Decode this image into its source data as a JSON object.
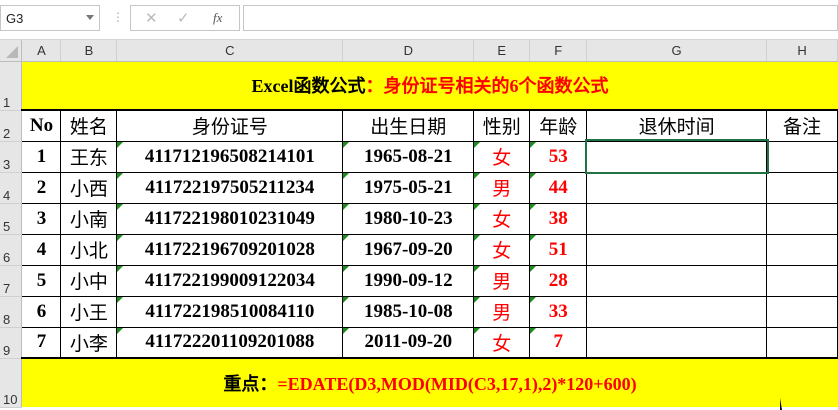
{
  "formula_bar": {
    "name_box": "G3",
    "cancel_icon": "✕",
    "enter_icon": "✓",
    "fx_label": "fx",
    "formula": ""
  },
  "columns": [
    "A",
    "B",
    "C",
    "D",
    "E",
    "F",
    "G",
    "H"
  ],
  "rows": [
    "1",
    "2",
    "3",
    "4",
    "5",
    "6",
    "7",
    "8",
    "9",
    "10"
  ],
  "title": {
    "prefix": "Excel函数公式",
    "sep": "：",
    "highlight": "身份证号相关的6个函数公式"
  },
  "headers": [
    "No",
    "姓名",
    "身份证号",
    "出生日期",
    "性别",
    "年龄",
    "退休时间",
    "备注"
  ],
  "records": [
    {
      "no": "1",
      "name": "王东",
      "id": "41171219650821410​1",
      "dob": "1965-08-21",
      "sex": "女",
      "age": "53"
    },
    {
      "no": "2",
      "name": "小西",
      "id": "411722197505211234",
      "dob": "1975-05-21",
      "sex": "男",
      "age": "44"
    },
    {
      "no": "3",
      "name": "小南",
      "id": "411722198010231049",
      "dob": "1980-10-23",
      "sex": "女",
      "age": "38"
    },
    {
      "no": "4",
      "name": "小北",
      "id": "411722196709201028",
      "dob": "1967-09-20",
      "sex": "女",
      "age": "51"
    },
    {
      "no": "5",
      "name": "小中",
      "id": "411722199009122034",
      "dob": "1990-09-12",
      "sex": "男",
      "age": "28"
    },
    {
      "no": "6",
      "name": "小王",
      "id": "411722198510084110",
      "dob": "1985-10-08",
      "sex": "男",
      "age": "33"
    },
    {
      "no": "7",
      "name": "小李",
      "id": "411722201109201088",
      "dob": "2011-09-20",
      "sex": "女",
      "age": "7"
    }
  ],
  "footer": {
    "label": "重点：",
    "formula": "=EDATE(D3,MOD(MID(C3,17,1),2)*120+600)"
  }
}
